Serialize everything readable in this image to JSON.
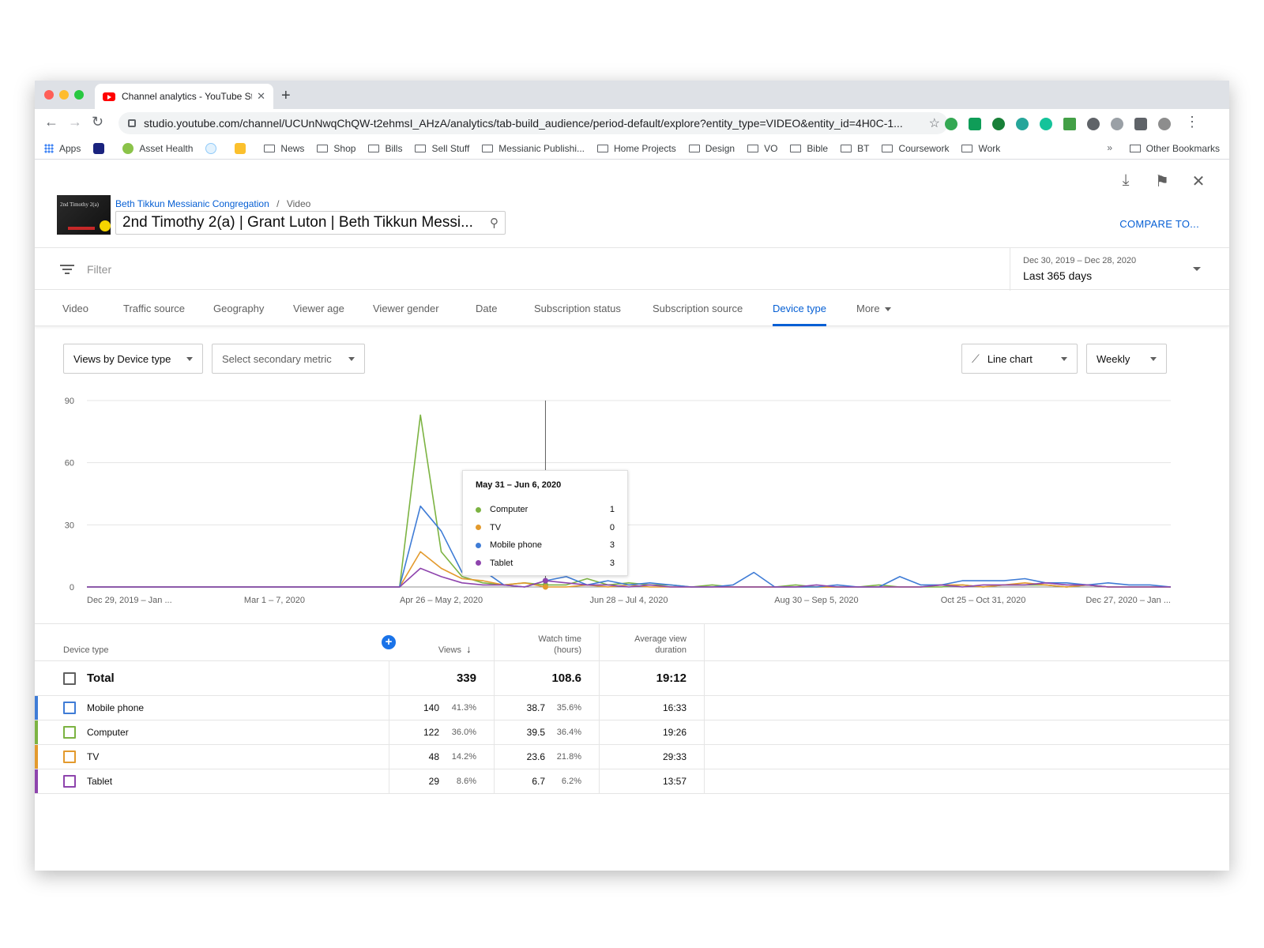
{
  "browser": {
    "tab_title": "Channel analytics - YouTube St",
    "url": "studio.youtube.com/channel/UCUnNwqChQW-t2ehmsI_AHzA/analytics/tab-build_audience/period-default/explore?entity_type=VIDEO&entity_id=4H0C-1...",
    "bookmarks": [
      "Apps",
      "Asset Health",
      "News",
      "Shop",
      "Bills",
      "Sell Stuff",
      "Messianic Publishi...",
      "Home Projects",
      "Design",
      "VO",
      "Bible",
      "BT",
      "Coursework",
      "Work"
    ],
    "other_bookmarks": "Other Bookmarks",
    "overflow": "»"
  },
  "header": {
    "channel": "Beth Tikkun Messianic Congregation",
    "separator": "/",
    "entity": "Video",
    "video_title": "2nd Timothy 2(a) | Grant Luton | Beth Tikkun Messi...",
    "thumb_text": "2nd Timothy 2(a)",
    "compare": "COMPARE TO..."
  },
  "filter": {
    "placeholder": "Filter",
    "date_range": "Dec 30, 2019 – Dec 28, 2020",
    "period": "Last 365 days"
  },
  "tabs": [
    "Video",
    "Traffic source",
    "Geography",
    "Viewer age",
    "Viewer gender",
    "Date",
    "Subscription status",
    "Subscription source",
    "Device type",
    "More"
  ],
  "active_tab": "Device type",
  "controls": {
    "primary_metric": "Views by Device type",
    "secondary_metric": "Select secondary metric",
    "chart_type": "Line chart",
    "granularity": "Weekly"
  },
  "chart_data": {
    "type": "line",
    "y_ticks": [
      0,
      30,
      60,
      90
    ],
    "ylim": [
      0,
      90
    ],
    "x_tick_labels": [
      "Dec 29, 2019 – Jan ...",
      "Mar 1 – 7, 2020",
      "Apr 26 – May 2, 2020",
      "Jun 28 – Jul 4, 2020",
      "Aug 30 – Sep 5, 2020",
      "Oct 25 – Oct 31, 2020",
      "Dec 27, 2020 – Jan ..."
    ],
    "x_tick_weeks": [
      0,
      9,
      17,
      26,
      35,
      43,
      52
    ],
    "weeks": 53,
    "hover_week": 22,
    "series": [
      {
        "name": "Computer",
        "color": "#7cb342",
        "values": [
          0,
          0,
          0,
          0,
          0,
          0,
          0,
          0,
          0,
          0,
          0,
          0,
          0,
          0,
          0,
          0,
          83,
          17,
          5,
          2,
          1,
          2,
          1,
          1,
          4,
          1,
          2,
          1,
          1,
          0,
          1,
          0,
          0,
          0,
          1,
          0,
          0,
          0,
          1,
          0,
          0,
          0,
          1,
          0,
          1,
          1,
          1,
          0,
          1,
          0,
          0,
          0,
          0
        ]
      },
      {
        "name": "TV",
        "color": "#e39a2d",
        "values": [
          0,
          0,
          0,
          0,
          0,
          0,
          0,
          0,
          0,
          0,
          0,
          0,
          0,
          0,
          0,
          0,
          17,
          9,
          4,
          3,
          1,
          2,
          0,
          0,
          1,
          0,
          1,
          0,
          0,
          0,
          0,
          0,
          0,
          0,
          0,
          0,
          0,
          0,
          0,
          0,
          0,
          1,
          1,
          0,
          1,
          2,
          1,
          0,
          1,
          0,
          0,
          0,
          0
        ]
      },
      {
        "name": "Mobile phone",
        "color": "#3f7cd6",
        "values": [
          0,
          0,
          0,
          0,
          0,
          0,
          0,
          0,
          0,
          0,
          0,
          0,
          0,
          0,
          0,
          0,
          39,
          27,
          7,
          8,
          1,
          0,
          3,
          5,
          1,
          3,
          1,
          2,
          1,
          0,
          0,
          1,
          7,
          0,
          0,
          0,
          1,
          0,
          0,
          5,
          1,
          1,
          3,
          3,
          3,
          4,
          2,
          2,
          1,
          2,
          1,
          1,
          0
        ]
      },
      {
        "name": "Tablet",
        "color": "#8e44ad",
        "values": [
          0,
          0,
          0,
          0,
          0,
          0,
          0,
          0,
          0,
          0,
          0,
          0,
          0,
          0,
          0,
          0,
          9,
          5,
          2,
          1,
          1,
          0,
          3,
          2,
          1,
          1,
          0,
          1,
          0,
          0,
          0,
          0,
          0,
          0,
          0,
          1,
          0,
          0,
          0,
          0,
          0,
          1,
          0,
          1,
          1,
          1,
          2,
          1,
          1,
          0,
          0,
          0,
          0
        ]
      }
    ],
    "tooltip": {
      "title": "May 31 – Jun 6, 2020",
      "rows": [
        {
          "name": "Computer",
          "value": "1",
          "color": "#7cb342"
        },
        {
          "name": "TV",
          "value": "0",
          "color": "#e39a2d"
        },
        {
          "name": "Mobile phone",
          "value": "3",
          "color": "#3f7cd6"
        },
        {
          "name": "Tablet",
          "value": "3",
          "color": "#8e44ad"
        }
      ]
    }
  },
  "table": {
    "headers": {
      "device": "Device type",
      "views": "Views",
      "watch_time_1": "Watch time",
      "watch_time_2": "(hours)",
      "avg_1": "Average view",
      "avg_2": "duration"
    },
    "total": {
      "label": "Total",
      "views": "339",
      "watch": "108.6",
      "avg": "19:12"
    },
    "rows": [
      {
        "name": "Mobile phone",
        "views": "140",
        "views_pct": "41.3%",
        "watch": "38.7",
        "watch_pct": "35.6%",
        "avg": "16:33",
        "color": "#3f7cd6"
      },
      {
        "name": "Computer",
        "views": "122",
        "views_pct": "36.0%",
        "watch": "39.5",
        "watch_pct": "36.4%",
        "avg": "19:26",
        "color": "#7cb342"
      },
      {
        "name": "TV",
        "views": "48",
        "views_pct": "14.2%",
        "watch": "23.6",
        "watch_pct": "21.8%",
        "avg": "29:33",
        "color": "#e39a2d"
      },
      {
        "name": "Tablet",
        "views": "29",
        "views_pct": "8.6%",
        "watch": "6.7",
        "watch_pct": "6.2%",
        "avg": "13:57",
        "color": "#8e44ad"
      }
    ]
  },
  "colors": {
    "accent": "#065fd4"
  }
}
